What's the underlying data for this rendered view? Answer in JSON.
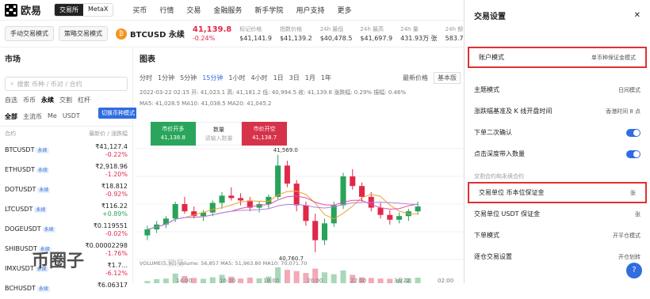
{
  "nav": {
    "brand": "欧易",
    "mode_on": "交易所",
    "mode_off": "MetaX",
    "items": [
      "买币",
      "行情",
      "交易",
      "金融服务",
      "新手学院",
      "用户支持",
      "更多"
    ]
  },
  "subbar": {
    "manual_mode": "手动交易模式",
    "strategy_mode": "策略交易模式",
    "pair": "BTCUSD 永续",
    "price": "41,139.8",
    "change": "-0.24%",
    "stats": [
      {
        "label": "标记价格",
        "value": "$41,141.9"
      },
      {
        "label": "指数价格",
        "value": "$41,139.2"
      },
      {
        "label": "24h 最低",
        "value": "$40,478.5"
      },
      {
        "label": "24h 最高",
        "value": "$41,697.9"
      },
      {
        "label": "24h 量",
        "value": "431.93万 张"
      },
      {
        "label": "24h 额",
        "value": "583.7"
      }
    ]
  },
  "market": {
    "title": "市场",
    "search_placeholder": "搜索 币种 / 币对 / 合约",
    "tabs": [
      "自选",
      "币币",
      "永续",
      "交割",
      "杠杆"
    ],
    "cats": [
      "全部",
      "主流币",
      "Me",
      "USDT"
    ],
    "col_left": "合约",
    "col_right": "最新价 / 涨跌幅",
    "tooltip": "切换币种模式",
    "rows": [
      {
        "sym": "BTCUSDT",
        "tag": "永续",
        "price": "₹41,127.4",
        "chg": "-0.22%",
        "dir": "down"
      },
      {
        "sym": "ETHUSDT",
        "tag": "永续",
        "price": "₹2,918.96",
        "chg": "-1.20%",
        "dir": "down"
      },
      {
        "sym": "DOTUSDT",
        "tag": "永续",
        "price": "₹18.812",
        "chg": "-0.92%",
        "dir": "down"
      },
      {
        "sym": "LTCUSDT",
        "tag": "永续",
        "price": "₹116.22",
        "chg": "+0.89%",
        "dir": "up"
      },
      {
        "sym": "DOGEUSDT",
        "tag": "永续",
        "price": "₹0.119551",
        "chg": "-0.02%",
        "dir": "down"
      },
      {
        "sym": "SHIBUSDT",
        "tag": "永续",
        "price": "₹0.00002298",
        "chg": "-1.76%",
        "dir": "down"
      },
      {
        "sym": "IMXUSDT",
        "tag": "永续",
        "price": "₹1.7...",
        "chg": "-6.12%",
        "dir": "down"
      },
      {
        "sym": "BCHUSDT",
        "tag": "永续",
        "price": "₹6.06317",
        "chg": "",
        "dir": "down"
      }
    ]
  },
  "chart": {
    "title": "图表",
    "times": [
      "分时",
      "1分钟",
      "5分钟",
      "15分钟",
      "1小时",
      "4小时",
      "1日",
      "3日",
      "1月",
      "1年"
    ],
    "active_time": "15分钟",
    "latest_price": "最新价格",
    "basic": "基本版",
    "info1": "2022-03-22 02:15  开: 41,023.1  高: 41,181.2  低: 40,994.5  收: 41,139.8  涨跌幅: 0.29%  振幅: 0.46%",
    "info2": "MA5: 41,028.5  MA10: 41,038.5  MA20: 41,045.2",
    "vol_info": "VOLUME(5,10)  Volume: 56,857  MA5: 51,963.80  MA10: 70,071.70",
    "high_label": "41,569.0",
    "low_label": "40,760.7",
    "buy": {
      "label": "市价开多",
      "value": "41,138.8"
    },
    "qty": {
      "label": "数量",
      "value": "请输入数量"
    },
    "sell": {
      "label": "市价开空",
      "value": "41,138.7"
    },
    "xticks": [
      "14:00",
      "16:00",
      "18:00",
      "20:00",
      "22:00",
      "3月22",
      "02:00"
    ],
    "watermark": "欧易",
    "chart_data": {
      "type": "candlestick",
      "ohlc": [
        [
          40900,
          40980,
          40860,
          40950
        ],
        [
          40950,
          41020,
          40920,
          40990
        ],
        [
          40990,
          41060,
          40960,
          41040
        ],
        [
          41040,
          41180,
          41010,
          41160
        ],
        [
          41160,
          41220,
          41080,
          41100
        ],
        [
          41100,
          41140,
          41040,
          41060
        ],
        [
          41060,
          41110,
          41020,
          41090
        ],
        [
          41090,
          41190,
          41060,
          41170
        ],
        [
          41170,
          41260,
          41120,
          41230
        ],
        [
          41230,
          41300,
          41190,
          41210
        ],
        [
          41210,
          41250,
          41150,
          41190
        ],
        [
          41190,
          41220,
          41100,
          41130
        ],
        [
          41130,
          41180,
          41090,
          41160
        ],
        [
          41160,
          41240,
          41120,
          41220
        ],
        [
          41220,
          41569,
          41200,
          41480
        ],
        [
          41480,
          41520,
          41300,
          41330
        ],
        [
          41330,
          41360,
          41100,
          41150
        ],
        [
          41150,
          41180,
          40980,
          41020
        ],
        [
          41020,
          41080,
          40760,
          40860
        ],
        [
          40860,
          41040,
          40820,
          41000
        ],
        [
          41000,
          41180,
          40970,
          41150
        ],
        [
          41150,
          41420,
          41120,
          41390
        ],
        [
          41390,
          41450,
          41280,
          41310
        ],
        [
          41310,
          41340,
          41180,
          41220
        ],
        [
          41220,
          41260,
          41100,
          41130
        ],
        [
          41130,
          41170,
          41040,
          41070
        ],
        [
          41070,
          41110,
          40990,
          41030
        ],
        [
          41030,
          41090,
          41000,
          41060
        ],
        [
          41060,
          41120,
          41020,
          41100
        ],
        [
          41100,
          41180,
          41070,
          41140
        ]
      ],
      "ylim": [
        40700,
        41620
      ],
      "volume": [
        30,
        45,
        50,
        90,
        70,
        55,
        48,
        60,
        80,
        65,
        50,
        58,
        52,
        66,
        140,
        120,
        110,
        95,
        130,
        100,
        85,
        115,
        80,
        60,
        55,
        50,
        48,
        45,
        52,
        57
      ]
    }
  },
  "settings": {
    "title": "交易设置",
    "rows": [
      {
        "label": "账户模式",
        "value": "单币种保证金模式",
        "boxed": true,
        "kind": "link"
      },
      {
        "label": "主题模式",
        "value": "日间模式",
        "kind": "select"
      },
      {
        "label": "涨跌幅基准及 K 线开盘时间",
        "value": "香港时间 8 点",
        "kind": "select"
      },
      {
        "label": "下单二次确认",
        "kind": "toggle"
      },
      {
        "label": "点击深度带入数量",
        "kind": "toggle"
      }
    ],
    "section": "交割合约和永续合约",
    "rows2": [
      {
        "label": "交易单位 币本位保证金",
        "value": "张",
        "boxed": true
      },
      {
        "label": "交易单位 USDT 保证金",
        "value": "张"
      },
      {
        "label": "下单模式",
        "value": "开平仓模式"
      },
      {
        "label": "逐仓交易设置",
        "value": "开仓划转"
      }
    ]
  },
  "watermark": "币圈子"
}
